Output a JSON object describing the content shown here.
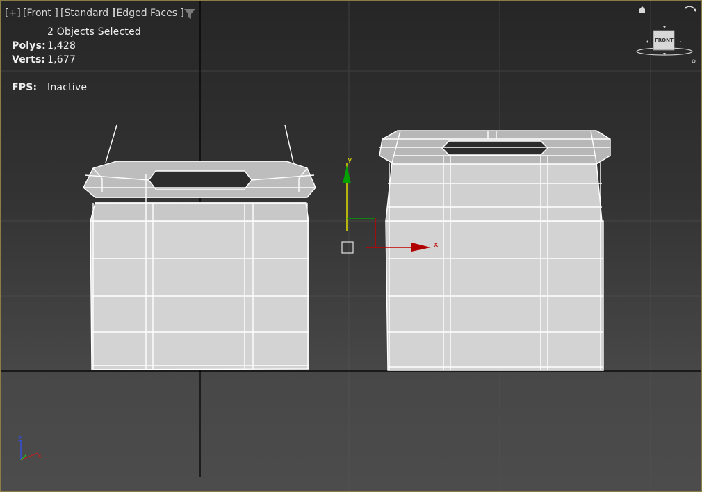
{
  "viewport": {
    "menu": {
      "plus": "[+]",
      "view": "[Front ]",
      "shading": "[Standard ]",
      "style": "[Edged Faces ]"
    },
    "stats": {
      "selection": "2 Objects Selected",
      "polys_label": "Polys:",
      "polys_value": "1,428",
      "verts_label": "Verts:",
      "verts_value": "1,677",
      "fps_label": "FPS:",
      "fps_value": "Inactive"
    },
    "viewcube_label": "FRONT",
    "gizmo": {
      "x_label": "x",
      "y_label": "y"
    },
    "axis_tripod": {
      "x_label": "x",
      "z_label": "z"
    }
  },
  "colors": {
    "frame_border": "#8a7d45",
    "mesh_fill": "#d4d4d4",
    "wire": "#ffffff",
    "gizmo_x": "#c00000",
    "gizmo_y": "#00a000",
    "gizmo_plane_y": "#e0e000",
    "grid_line": "#000000"
  }
}
